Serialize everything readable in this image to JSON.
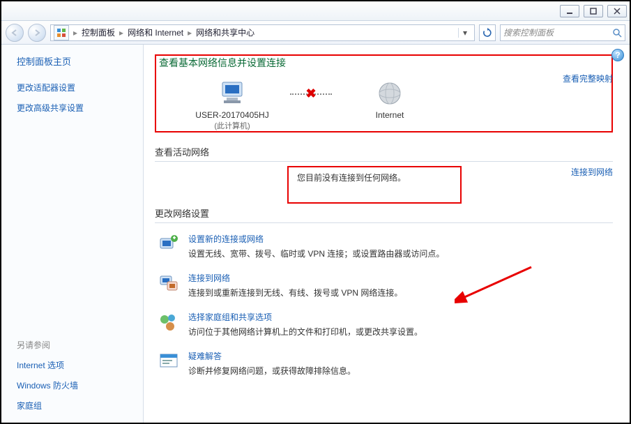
{
  "breadcrumb": {
    "items": [
      "控制面板",
      "网络和 Internet",
      "网络和共享中心"
    ]
  },
  "search": {
    "placeholder": "搜索控制面板"
  },
  "sidebar": {
    "title": "控制面板主页",
    "links": [
      "更改适配器设置",
      "更改高级共享设置"
    ],
    "also_title": "另请参阅",
    "also_links": [
      "Internet 选项",
      "Windows 防火墙",
      "家庭组"
    ]
  },
  "main": {
    "heading": "查看基本网络信息并设置连接",
    "full_map_link": "查看完整映射",
    "diagram": {
      "pc_label": "USER-20170405HJ",
      "pc_sub": "(此计算机)",
      "internet_label": "Internet"
    },
    "active_net_title": "查看活动网络",
    "connect_link": "连接到网络",
    "no_network_msg": "您目前没有连接到任何网络。",
    "change_settings_title": "更改网络设置",
    "options": [
      {
        "title": "设置新的连接或网络",
        "desc": "设置无线、宽带、拨号、临时或 VPN 连接；或设置路由器或访问点。"
      },
      {
        "title": "连接到网络",
        "desc": "连接到或重新连接到无线、有线、拨号或 VPN 网络连接。"
      },
      {
        "title": "选择家庭组和共享选项",
        "desc": "访问位于其他网络计算机上的文件和打印机，或更改共享设置。"
      },
      {
        "title": "疑难解答",
        "desc": "诊断并修复网络问题，或获得故障排除信息。"
      }
    ]
  }
}
